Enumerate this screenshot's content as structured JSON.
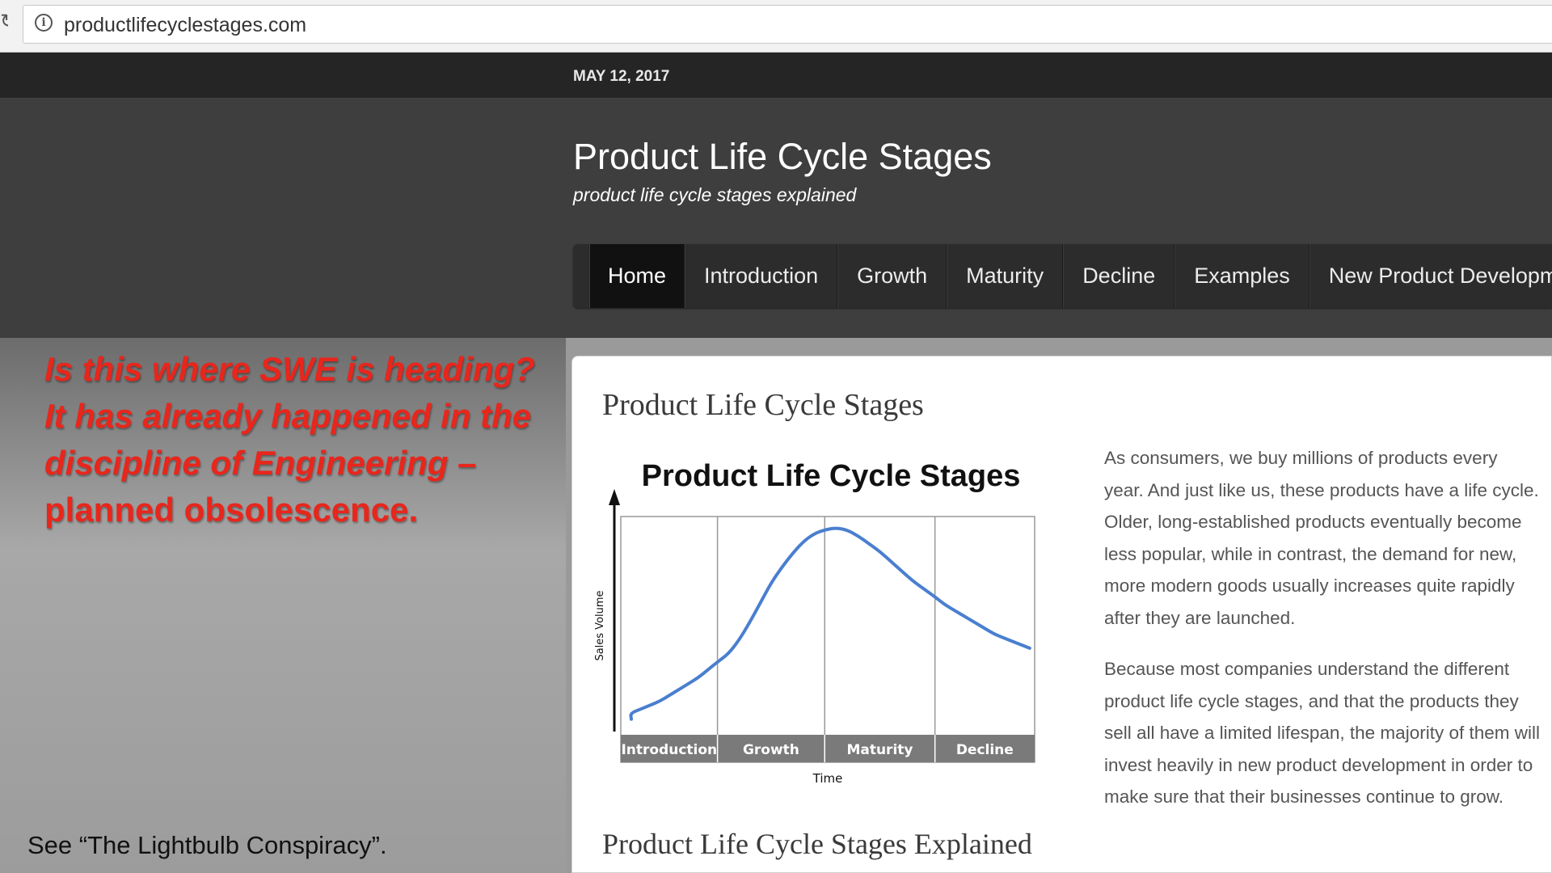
{
  "browser": {
    "url": "productlifecyclestages.com"
  },
  "site": {
    "date": "MAY 12, 2017",
    "title": "Product Life Cycle Stages",
    "tagline": "product life cycle stages explained",
    "nav": [
      "Home",
      "Introduction",
      "Growth",
      "Maturity",
      "Decline",
      "Examples",
      "New Product Development"
    ]
  },
  "overlay": {
    "lines": [
      "Is this where SWE is heading?",
      "It has already happened in the",
      "discipline of Engineering –",
      "planned obsolescence."
    ],
    "footnote": "See “The Lightbulb Conspiracy”."
  },
  "article": {
    "title": "Product Life Cycle Stages",
    "subtitle": "Product Life Cycle Stages Explained",
    "paragraphs": [
      "As consumers, we buy millions of products every year. And just like us, these products have a life cycle. Older, long-established products eventually become less popular, while in contrast, the demand for new, more modern goods usually increases quite rapidly after they are launched.",
      "Because most companies understand the different product life cycle stages, and that the products they sell all have a limited lifespan, the majority of them will invest heavily in new product development in order to make sure that their businesses continue to grow."
    ]
  },
  "chart_data": {
    "type": "line",
    "title": "Product Life Cycle Stages",
    "xlabel": "Time",
    "ylabel": "Sales Volume",
    "categories": [
      "Introduction",
      "Growth",
      "Maturity",
      "Decline"
    ],
    "series": [
      {
        "color": "#4a7fcf",
        "x": [
          0,
          0.1,
          0.2,
          0.3,
          0.4,
          0.5,
          0.6,
          0.7,
          0.8,
          0.9,
          1.0,
          1.1,
          1.2,
          1.3,
          1.4,
          1.5,
          1.6,
          1.7,
          1.8,
          1.9,
          2.0,
          2.1,
          2.2,
          2.3,
          2.4,
          2.5,
          2.6,
          2.7,
          2.8,
          2.9,
          3.0,
          3.1,
          3.2,
          3.3,
          3.4,
          3.5,
          3.6,
          3.7,
          3.8,
          3.9,
          4.0
        ],
        "y": [
          0.03,
          0.06,
          0.08,
          0.1,
          0.12,
          0.15,
          0.18,
          0.21,
          0.24,
          0.28,
          0.32,
          0.36,
          0.43,
          0.52,
          0.62,
          0.72,
          0.8,
          0.87,
          0.93,
          0.97,
          0.99,
          1.0,
          0.99,
          0.96,
          0.92,
          0.88,
          0.83,
          0.78,
          0.73,
          0.69,
          0.65,
          0.61,
          0.58,
          0.55,
          0.52,
          0.49,
          0.46,
          0.44,
          0.42,
          0.4,
          0.39
        ]
      }
    ],
    "grid": false,
    "legend": "none",
    "colors": {
      "axis_band": "#7a7a7a",
      "band_text": "#ffffff"
    }
  }
}
